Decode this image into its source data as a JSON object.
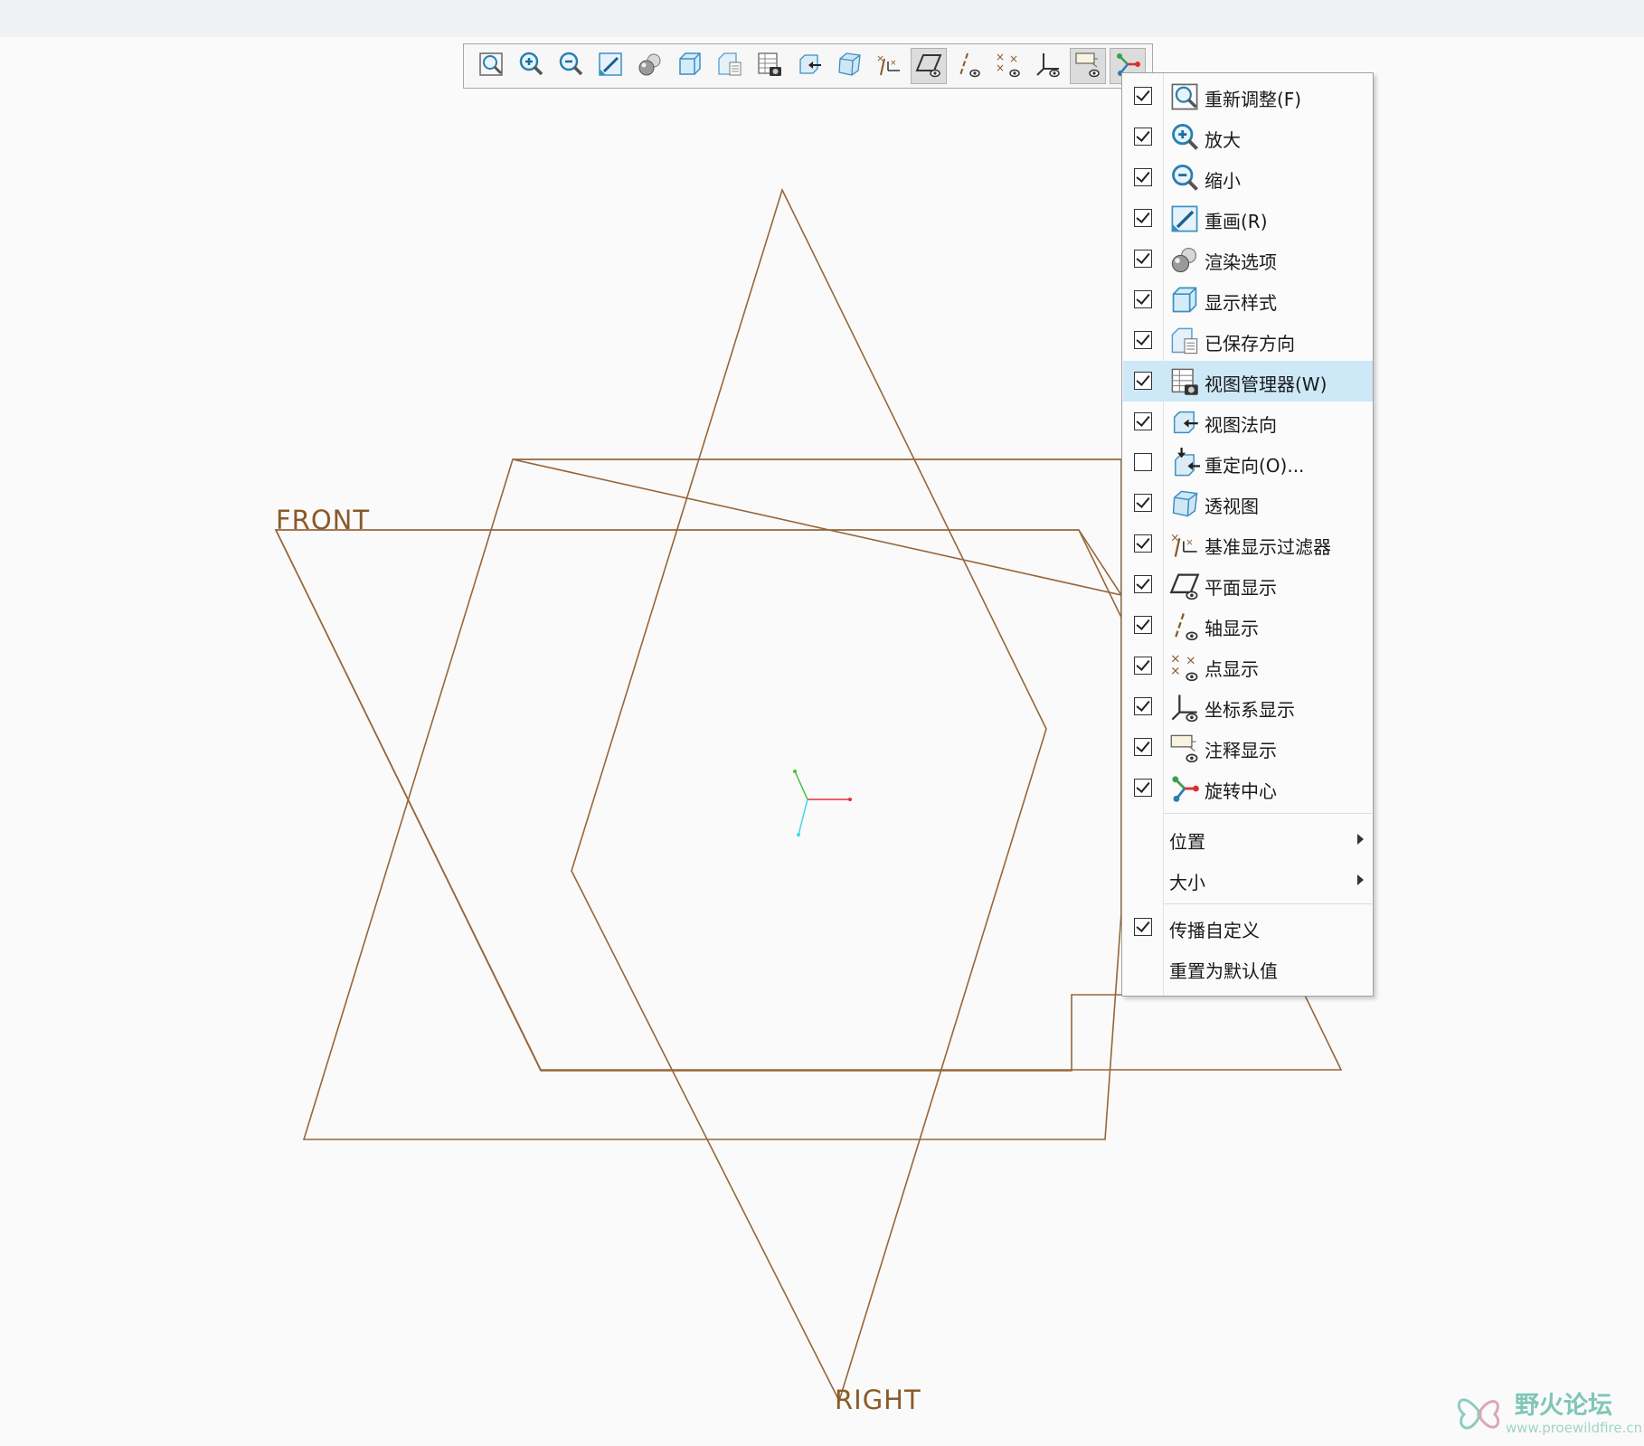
{
  "viewport": {
    "plane_labels": {
      "front": "FRONT",
      "right": "RIGHT"
    },
    "plane_color": "#8a5a28"
  },
  "toolbar": {
    "buttons": [
      {
        "icon": "refit-icon"
      },
      {
        "icon": "zoom-in-icon"
      },
      {
        "icon": "zoom-out-icon"
      },
      {
        "icon": "repaint-icon"
      },
      {
        "icon": "render-options-icon"
      },
      {
        "icon": "display-style-icon"
      },
      {
        "icon": "saved-orientations-icon"
      },
      {
        "icon": "view-manager-icon"
      },
      {
        "icon": "view-normal-icon"
      },
      {
        "icon": "perspective-icon"
      },
      {
        "icon": "datum-filter-icon"
      },
      {
        "icon": "plane-display-icon",
        "active": true
      },
      {
        "icon": "axis-display-icon"
      },
      {
        "icon": "point-display-icon"
      },
      {
        "icon": "csys-display-icon"
      },
      {
        "icon": "annotation-display-icon",
        "active": true
      },
      {
        "icon": "spin-center-icon",
        "active": true
      }
    ]
  },
  "menu": {
    "items": [
      {
        "label": "重新调整(F)",
        "checked": true,
        "icon": "refit-icon"
      },
      {
        "label": "放大",
        "checked": true,
        "icon": "zoom-in-icon"
      },
      {
        "label": "缩小",
        "checked": true,
        "icon": "zoom-out-icon"
      },
      {
        "label": "重画(R)",
        "checked": true,
        "icon": "repaint-icon"
      },
      {
        "label": "渲染选项",
        "checked": true,
        "icon": "render-options-icon"
      },
      {
        "label": "显示样式",
        "checked": true,
        "icon": "display-style-icon"
      },
      {
        "label": "已保存方向",
        "checked": true,
        "icon": "saved-orientations-icon"
      },
      {
        "label": "视图管理器(W)",
        "checked": true,
        "icon": "view-manager-icon",
        "highlighted": true
      },
      {
        "label": "视图法向",
        "checked": true,
        "icon": "view-normal-icon"
      },
      {
        "label": "重定向(O)...",
        "checked": false,
        "icon": "reorient-icon"
      },
      {
        "label": "透视图",
        "checked": true,
        "icon": "perspective-icon"
      },
      {
        "label": "基准显示过滤器",
        "checked": true,
        "icon": "datum-filter-icon"
      },
      {
        "label": "平面显示",
        "checked": true,
        "icon": "plane-display-icon"
      },
      {
        "label": "轴显示",
        "checked": true,
        "icon": "axis-display-icon"
      },
      {
        "label": "点显示",
        "checked": true,
        "icon": "point-display-icon"
      },
      {
        "label": "坐标系显示",
        "checked": true,
        "icon": "csys-display-icon"
      },
      {
        "label": "注释显示",
        "checked": true,
        "icon": "annotation-display-icon"
      },
      {
        "label": "旋转中心",
        "checked": true,
        "icon": "spin-center-icon"
      }
    ],
    "submenus": [
      {
        "label": "位置"
      },
      {
        "label": "大小"
      }
    ],
    "footer": [
      {
        "label": "传播自定义",
        "checked": true
      },
      {
        "label": "重置为默认值",
        "checked": null
      }
    ]
  },
  "watermark": {
    "text": "野火论坛",
    "url": "www.proewildfire.cn"
  }
}
